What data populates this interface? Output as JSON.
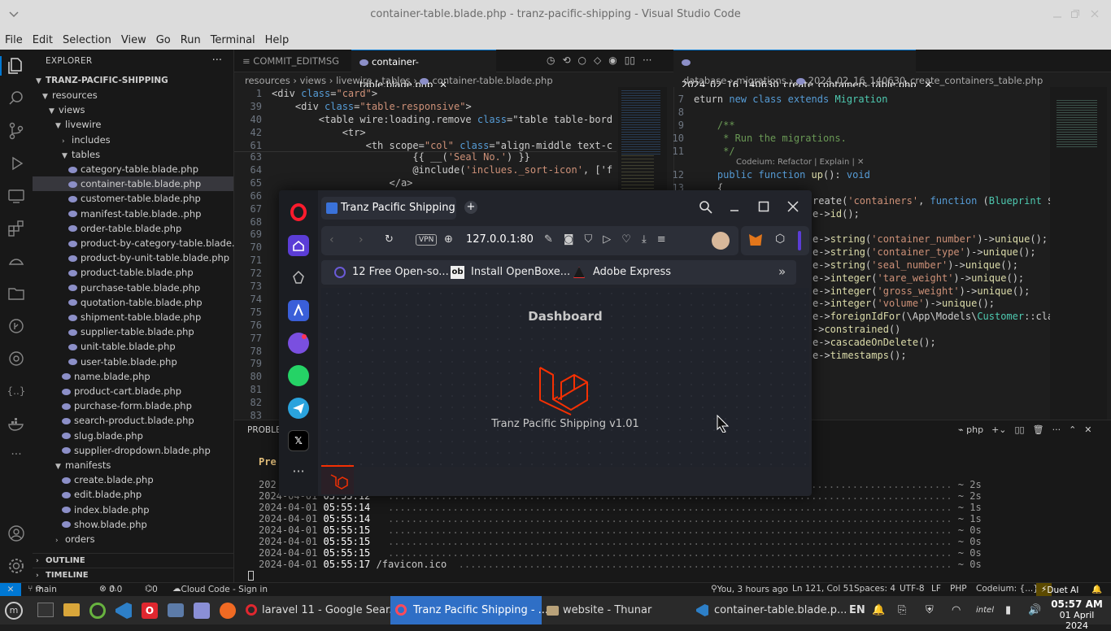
{
  "window": {
    "title": "container-table.blade.php - tranz-pacific-shipping - Visual Studio Code"
  },
  "menu": [
    "File",
    "Edit",
    "Selection",
    "View",
    "Go",
    "Run",
    "Terminal",
    "Help"
  ],
  "explorer": {
    "header": "EXPLORER",
    "project": "TRANZ-PACIFIC-SHIPPING",
    "rows": [
      {
        "label": "resources",
        "kind": "folder-open",
        "depth": 1
      },
      {
        "label": "views",
        "kind": "folder-open",
        "depth": 2
      },
      {
        "label": "livewire",
        "kind": "folder-open",
        "depth": 3
      },
      {
        "label": "includes",
        "kind": "folder-closed",
        "depth": 4
      },
      {
        "label": "tables",
        "kind": "folder-open",
        "depth": 4
      },
      {
        "label": "category-table.blade.php",
        "kind": "file",
        "depth": 5
      },
      {
        "label": "container-table.blade.php",
        "kind": "file",
        "depth": 5,
        "selected": true
      },
      {
        "label": "customer-table.blade.php",
        "kind": "file",
        "depth": 5
      },
      {
        "label": "manifest-table.blade..php",
        "kind": "file",
        "depth": 5
      },
      {
        "label": "order-table.blade.php",
        "kind": "file",
        "depth": 5
      },
      {
        "label": "product-by-category-table.blade.php",
        "kind": "file",
        "depth": 5
      },
      {
        "label": "product-by-unit-table.blade.php",
        "kind": "file",
        "depth": 5
      },
      {
        "label": "product-table.blade.php",
        "kind": "file",
        "depth": 5
      },
      {
        "label": "purchase-table.blade.php",
        "kind": "file",
        "depth": 5
      },
      {
        "label": "quotation-table.blade.php",
        "kind": "file",
        "depth": 5
      },
      {
        "label": "shipment-table.blade.php",
        "kind": "file",
        "depth": 5
      },
      {
        "label": "supplier-table.blade.php",
        "kind": "file",
        "depth": 5
      },
      {
        "label": "unit-table.blade.php",
        "kind": "file",
        "depth": 5
      },
      {
        "label": "user-table.blade.php",
        "kind": "file",
        "depth": 5
      },
      {
        "label": "name.blade.php",
        "kind": "file",
        "depth": 4
      },
      {
        "label": "product-cart.blade.php",
        "kind": "file",
        "depth": 4
      },
      {
        "label": "purchase-form.blade.php",
        "kind": "file",
        "depth": 4
      },
      {
        "label": "search-product.blade.php",
        "kind": "file",
        "depth": 4
      },
      {
        "label": "slug.blade.php",
        "kind": "file",
        "depth": 4
      },
      {
        "label": "supplier-dropdown.blade.php",
        "kind": "file",
        "depth": 4
      },
      {
        "label": "manifests",
        "kind": "folder-open",
        "depth": 3
      },
      {
        "label": "create.blade.php",
        "kind": "file",
        "depth": 4
      },
      {
        "label": "edit.blade.php",
        "kind": "file",
        "depth": 4
      },
      {
        "label": "index.blade.php",
        "kind": "file",
        "depth": 4
      },
      {
        "label": "show.blade.php",
        "kind": "file",
        "depth": 4
      },
      {
        "label": "orders",
        "kind": "folder-closed",
        "depth": 3
      }
    ],
    "outline": "OUTLINE",
    "timeline": "TIMELINE"
  },
  "editor_left": {
    "tabs": [
      {
        "label": "COMMIT_EDITMSG",
        "active": false
      },
      {
        "label": "container-table.blade.php",
        "active": true
      }
    ],
    "breadcrumb": [
      "resources",
      "views",
      "livewire",
      "tables",
      "container-table.blade.php"
    ],
    "sticky": [
      {
        "n": "1",
        "text": "<div class=\"card\">"
      },
      {
        "n": "39",
        "text": "    <div class=\"table-responsive\">"
      },
      {
        "n": "40",
        "text": "        <table wire:loading.remove class=\"table table-bord"
      },
      {
        "n": "42",
        "text": "            <tr>"
      },
      {
        "n": "61",
        "text": "                <th scope=\"col\" class=\"align-middle text-c"
      }
    ],
    "lines": [
      {
        "n": "63",
        "text": "                        {{ __('Seal No.') }}"
      },
      {
        "n": "64",
        "text": "                        @include('inclues._sort-icon', ['f"
      },
      {
        "n": "65",
        "text": "                    </a>"
      },
      {
        "n": "66",
        "text": ""
      },
      {
        "n": "67",
        "text": ""
      },
      {
        "n": "68",
        "text": ""
      },
      {
        "n": "69",
        "text": ""
      },
      {
        "n": "70",
        "text": ""
      },
      {
        "n": "71",
        "text": ""
      },
      {
        "n": "72",
        "text": ""
      },
      {
        "n": "73",
        "text": ""
      },
      {
        "n": "74",
        "text": ""
      },
      {
        "n": "75",
        "text": ""
      },
      {
        "n": "76",
        "text": ""
      },
      {
        "n": "77",
        "text": ""
      },
      {
        "n": "78",
        "text": ""
      },
      {
        "n": "79",
        "text": ""
      },
      {
        "n": "80",
        "text": ""
      },
      {
        "n": "81",
        "text": ""
      },
      {
        "n": "82",
        "text": ""
      },
      {
        "n": "83",
        "text": ""
      }
    ]
  },
  "editor_right": {
    "tab": "2024_02_16_140630_create_containers_table.php",
    "breadcrumb": [
      "database",
      "migrations",
      "2024_02_16_140630_create_containers_table.php"
    ],
    "lines": [
      {
        "n": "7",
        "text": "eturn new class extends Migration"
      },
      {
        "n": "8",
        "text": ""
      },
      {
        "n": "9",
        "text": "    /**"
      },
      {
        "n": "10",
        "text": "     * Run the migrations."
      },
      {
        "n": "11",
        "text": "     */"
      },
      {
        "n": "12",
        "text": "    public function up(): void"
      },
      {
        "n": "13",
        "text": "    {"
      }
    ],
    "codelens": "Codeium: Refactor | Explain | ✕",
    "visible_tail": [
      "reate('containers', function (Blueprint $t",
      "e->id();",
      "",
      "e->string('container_number')->unique();",
      "e->string('container_type')->unique();",
      "e->string('seal_number')->unique();",
      "e->integer('tare_weight')->unique();",
      "e->integer('gross_weight')->unique();",
      "e->integer('volume')->unique();",
      "e->foreignIdFor(\\App\\Models\\Customer::clas",
      "->constrained()",
      "e->cascadeOnDelete();",
      "e->timestamps();"
    ]
  },
  "panel": {
    "tab_label": "PROBLE",
    "prefix": "Pre",
    "shell": "php",
    "log": [
      {
        "date": "202",
        "time": "",
        "path": "",
        "dur": "~ 2s"
      },
      {
        "date": "2024-04-01",
        "time": "05:55:12",
        "path": "",
        "dur": "~ 2s"
      },
      {
        "date": "2024-04-01",
        "time": "05:55:14",
        "path": "",
        "dur": "~ 1s"
      },
      {
        "date": "2024-04-01",
        "time": "05:55:14",
        "path": "",
        "dur": "~ 1s"
      },
      {
        "date": "2024-04-01",
        "time": "05:55:15",
        "path": "",
        "dur": "~ 0s"
      },
      {
        "date": "2024-04-01",
        "time": "05:55:15",
        "path": "",
        "dur": "~ 0s"
      },
      {
        "date": "2024-04-01",
        "time": "05:55:15",
        "path": "",
        "dur": "~ 0s"
      },
      {
        "date": "2024-04-01",
        "time": "05:55:17",
        "path": "/favicon.ico",
        "dur": "~ 0s"
      }
    ]
  },
  "statusbar": {
    "branch": "main",
    "errors": "0",
    "warnings": "0",
    "ports": "0",
    "cloud": "Cloud Code - Sign in",
    "blame": "You, 3 hours ago",
    "position": "Ln 121, Col 51",
    "spaces": "Spaces: 4",
    "encoding": "UTF-8",
    "eol": "LF",
    "language": "PHP",
    "codeium": "Codeium: {...}",
    "duet": "Duet AI"
  },
  "browser": {
    "tab_title": "Tranz Pacific Shipping",
    "vpn": "VPN",
    "url": "127.0.0.1:80",
    "bookmarks": [
      "12 Free Open-so...",
      "Install OpenBoxe...",
      "Adobe Express"
    ],
    "bookmark_badge": "ob",
    "page_heading": "Dashboard",
    "app_name": "Tranz Pacific Shipping v1.01"
  },
  "taskbar": {
    "items": [
      {
        "label": "laravel 11 - Google Sear...",
        "active": false
      },
      {
        "label": "Tranz Pacific Shipping - ...",
        "active": true
      },
      {
        "label": "website - Thunar",
        "active": false
      },
      {
        "label": "container-table.blade.p...",
        "active": false
      }
    ],
    "lang": "EN",
    "time": "05:57 AM",
    "date": "01 April 2024"
  },
  "colors": {
    "accent": "#0078d4",
    "laravel": "#f53003",
    "opera": "#ff1b2d",
    "keyword": "#569cd6",
    "string": "#ce9178",
    "function": "#dcdcaa",
    "class": "#4ec9b0"
  }
}
